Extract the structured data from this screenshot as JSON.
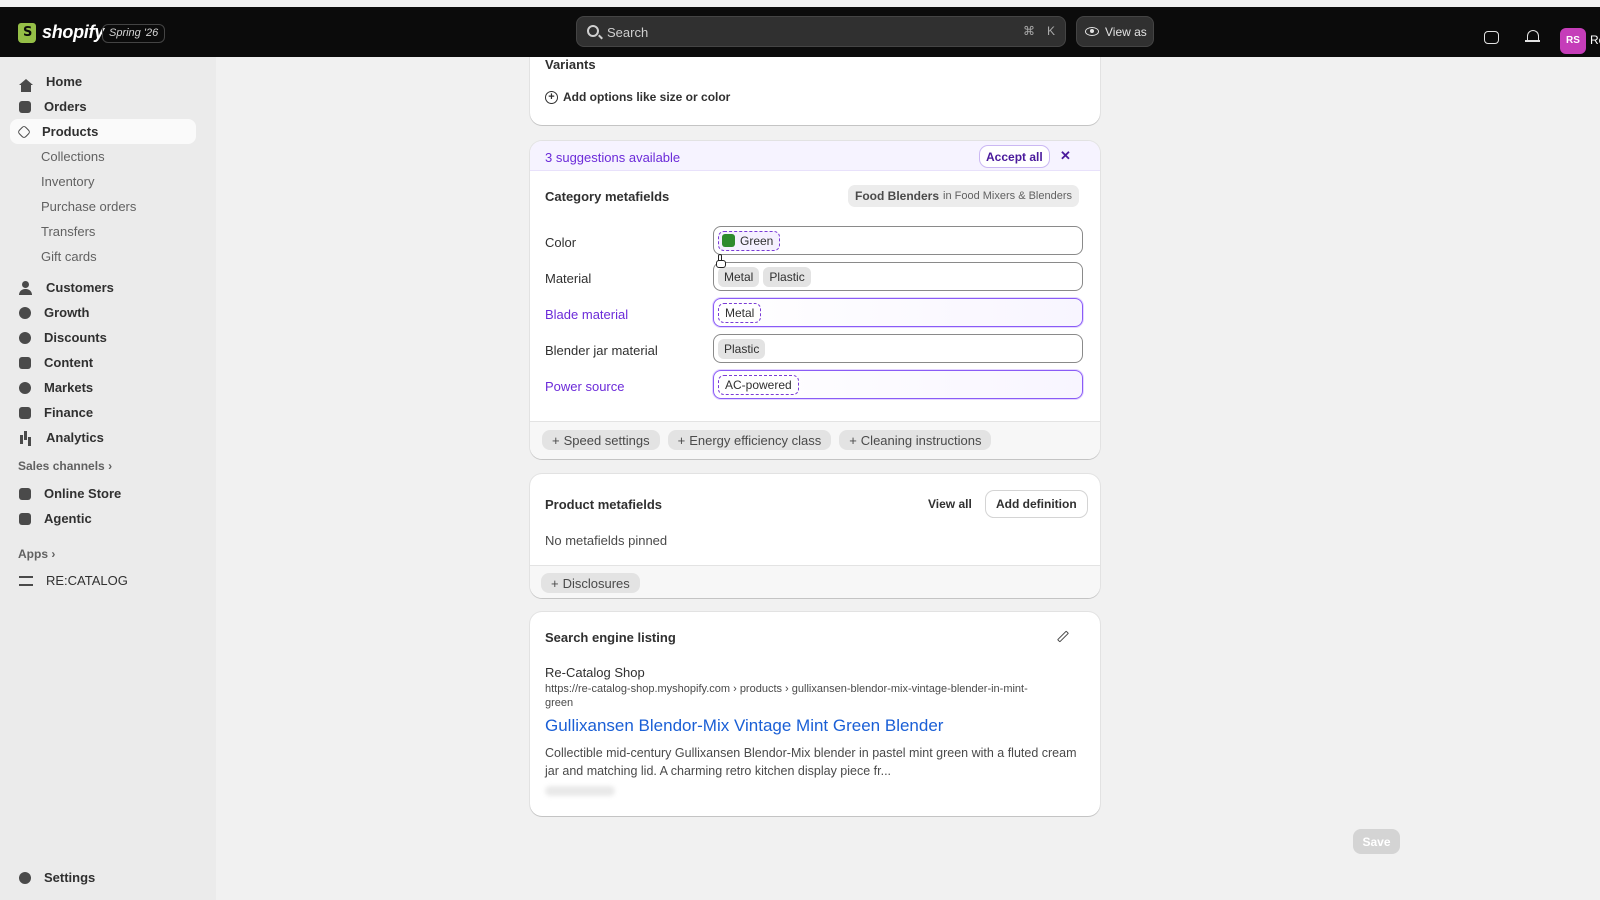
{
  "topbar": {
    "brand": "shopify",
    "edition": "Spring '26",
    "search_placeholder": "Search",
    "search_shortcut_cmd": "⌘",
    "search_shortcut_key": "K",
    "view_as": "View as",
    "avatar_initials": "RS",
    "avatar_name": "Re"
  },
  "sidebar": {
    "home": "Home",
    "orders": "Orders",
    "products": "Products",
    "product_sub": [
      "Collections",
      "Inventory",
      "Purchase orders",
      "Transfers",
      "Gift cards"
    ],
    "customers": "Customers",
    "growth": "Growth",
    "discounts": "Discounts",
    "content": "Content",
    "markets": "Markets",
    "finance": "Finance",
    "analytics": "Analytics",
    "sales_channels": "Sales channels",
    "online_store": "Online Store",
    "agentic": "Agentic",
    "apps": "Apps",
    "recatalog": "RE:CATALOG",
    "settings": "Settings"
  },
  "variants": {
    "title": "Variants",
    "add_options": "Add options like size or color"
  },
  "suggestions": {
    "banner": "3 suggestions available",
    "accept_all": "Accept all",
    "dismiss": "✕"
  },
  "category_metafields": {
    "title": "Category metafields",
    "category_name": "Food Blenders",
    "category_path": "in Food Mixers & Blenders",
    "rows": [
      {
        "label": "Color",
        "values": [
          "Green"
        ]
      },
      {
        "label": "Material",
        "values": [
          "Metal",
          "Plastic"
        ]
      },
      {
        "label": "Blade material",
        "values": [
          "Metal"
        ]
      },
      {
        "label": "Blender jar material",
        "values": [
          "Plastic"
        ]
      },
      {
        "label": "Power source",
        "values": [
          "AC-powered"
        ]
      }
    ],
    "color_swatch": "#2e8b2e",
    "add_buttons": [
      "Speed settings",
      "Energy efficiency class",
      "Cleaning instructions"
    ]
  },
  "product_metafields": {
    "title": "Product metafields",
    "view_all": "View all",
    "add_definition": "Add definition",
    "empty": "No metafields pinned",
    "add_button": "Disclosures"
  },
  "seo": {
    "title": "Search engine listing",
    "shop_name": "Re-Catalog Shop",
    "url": "https://re-catalog-shop.myshopify.com › products › gullixansen-blendor-mix-vintage-blender-in-mint-green",
    "page_title": "Gullixansen Blendor-Mix Vintage Mint Green Blender",
    "description": "Collectible mid-century Gullixansen Blendor-Mix blender in pastel mint green with a fluted cream jar and matching lid. A charming retro kitchen display piece fr..."
  },
  "save": "Save",
  "colors": {
    "suggestion_purple": "#6c2bd9",
    "seo_link": "#1a5fd6"
  }
}
